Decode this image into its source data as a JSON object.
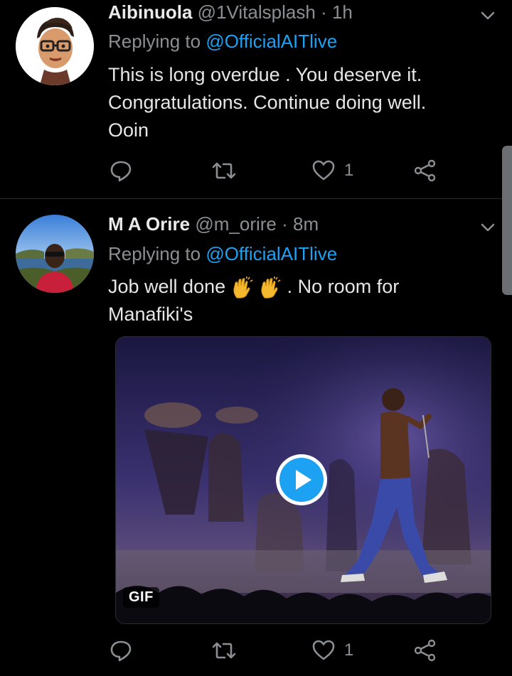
{
  "tweets": [
    {
      "name": "Aibinuola",
      "handle": "@1Vitalsplash",
      "dot": "·",
      "time": "1h",
      "replying_prefix": "Replying to",
      "replying_to": "@OfficialAITlive",
      "text_lines": [
        "This is long overdue . You deserve it.",
        "Congratulations. Continue doing well.",
        "Ooin"
      ],
      "likes": "1",
      "avatar_icon": "cartoon-avatar-glasses"
    },
    {
      "name": "M A Orire",
      "handle": "@m_orire",
      "dot": "·",
      "time": "8m",
      "replying_prefix": "Replying to",
      "replying_to": "@OfficialAITlive",
      "text_line1_a": "Job well done",
      "text_line1_b": ". No room for",
      "text_line2": "Manafiki's",
      "emojis": [
        "clapping-hands-emoji",
        "clapping-hands-emoji"
      ],
      "likes": "1",
      "media_badge": "GIF",
      "avatar_icon": "photo-avatar-sunglasses"
    }
  ],
  "colors": {
    "background": "#000000",
    "accent": "#1da1f2",
    "muted": "#8b8f94",
    "divider": "#2a2d30"
  }
}
